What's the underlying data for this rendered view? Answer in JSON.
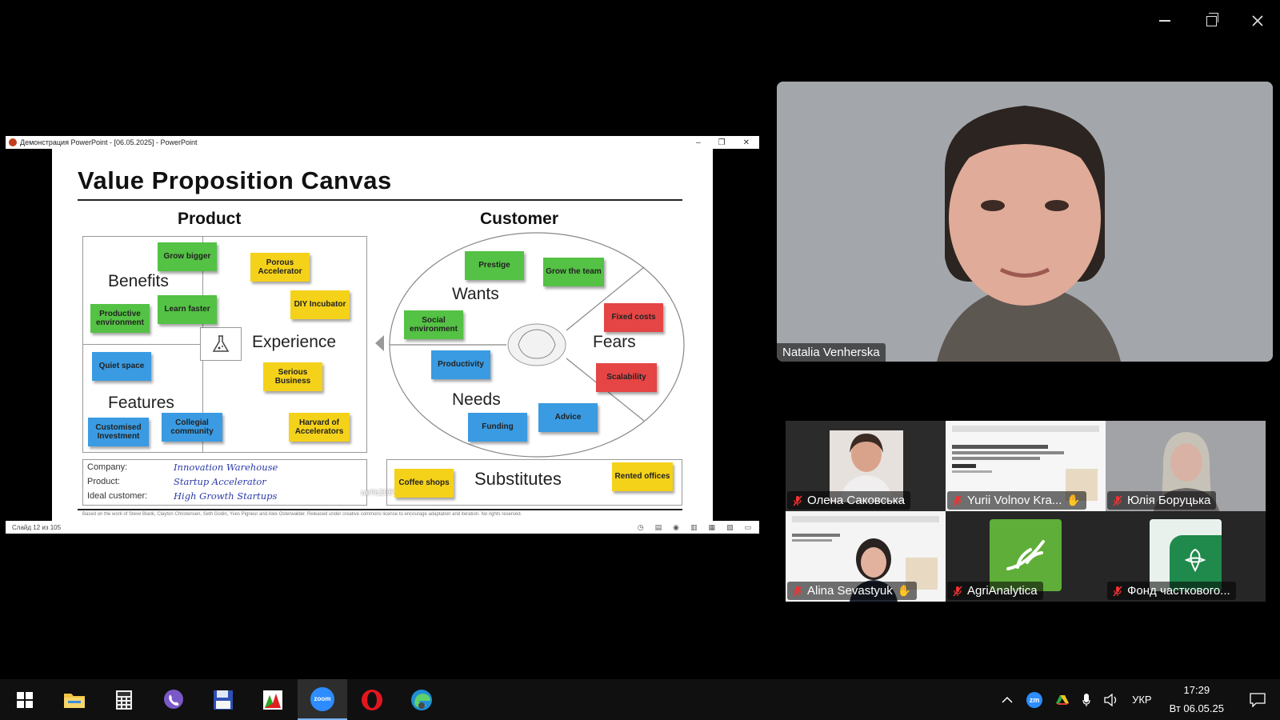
{
  "window_controls": {
    "minimize": "minimize",
    "restore": "restore",
    "close": "close"
  },
  "share": {
    "window_title": "Демонстрация PowerPoint - [06.05.2025] - PowerPoint",
    "status_left": "Слайд 12 из 105",
    "slide": {
      "title": "Value Proposition Canvas",
      "product_heading": "Product",
      "customer_heading": "Customer",
      "benefits": "Benefits",
      "features": "Features",
      "experience": "Experience",
      "wants": "Wants",
      "needs": "Needs",
      "fears": "Fears",
      "substitutes": "Substitutes",
      "notes": {
        "grow_bigger": "Grow bigger",
        "productive_env": "Productive environment",
        "learn_faster": "Learn faster",
        "quiet_space": "Quiet space",
        "customised_investment": "Customised Investment",
        "collegial_community": "Collegial community",
        "porous_accelerator": "Porous Accelerator",
        "diy_incubator": "DIY Incubator",
        "serious_business": "Serious Business",
        "harvard": "Harvard of Accelerators",
        "prestige": "Prestige",
        "grow_team": "Grow the team",
        "social_env": "Social environment",
        "fixed_costs": "Fixed costs",
        "productivity": "Productivity",
        "scalability": "Scalability",
        "advice": "Advice",
        "funding": "Funding",
        "coffee_shops": "Coffee shops",
        "rented_offices": "Rented offices"
      },
      "company_label": "Company:",
      "company_value": "Innovation Warehouse",
      "product_label": "Product:",
      "product_value": "Startup Accelerator",
      "customer_label": "Ideal customer:",
      "customer_value": "High Growth Startups",
      "overlay_text": "ue%205%20",
      "footnote": "Based on the work of Steve Blank, Clayton Christensen, Seth Godin, Yves Pigneur and Alex Osterwalder. Released under creative commons license to encourage adaptation and iteration. No rights reserved."
    }
  },
  "speaker": {
    "name": "Natalia Venherska"
  },
  "gallery": [
    {
      "name": "Олена Саковська"
    },
    {
      "name": "Yurii Volnov Kra..."
    },
    {
      "name": "Юлія Боруцька"
    },
    {
      "name": "Alina Sevastyuk"
    },
    {
      "name": "AgriAnalytica"
    },
    {
      "name": "Фонд часткового..."
    }
  ],
  "taskbar": {
    "zoom_label": "zoom",
    "tray_zm": "zm",
    "lang": "УКР",
    "time": "17:29",
    "date": "Вт 06.05.25"
  },
  "colors": {
    "note_green": "#54c244",
    "note_yellow": "#f5d21a",
    "note_blue": "#3a9be2",
    "note_red": "#e64545"
  }
}
